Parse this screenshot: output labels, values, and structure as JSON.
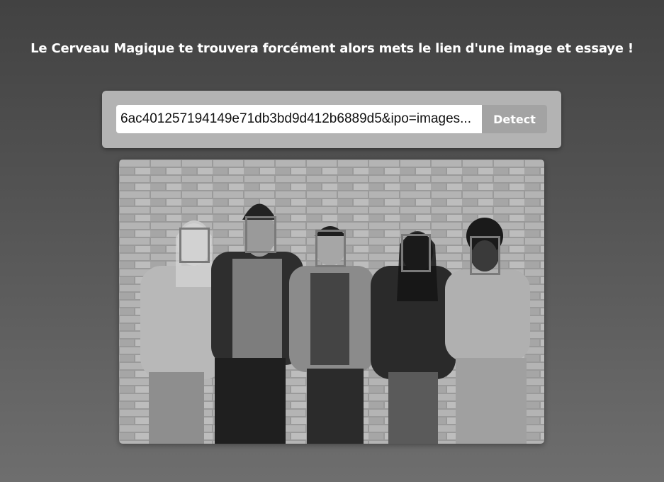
{
  "header": {
    "title": "Le Cerveau Magique te trouvera forcément alors mets le lien d'une image et essaye !"
  },
  "form": {
    "url_value": "...6ac401257194149e71db3bd9d412b6889d5&ipo=images",
    "detect_label": "Detect"
  },
  "result": {
    "faces_detected": 5,
    "box_color": "#7a7a7a"
  },
  "colors": {
    "form_bg": "#b3b3b3",
    "button_bg": "#a3a3a3",
    "text": "#ffffff"
  }
}
